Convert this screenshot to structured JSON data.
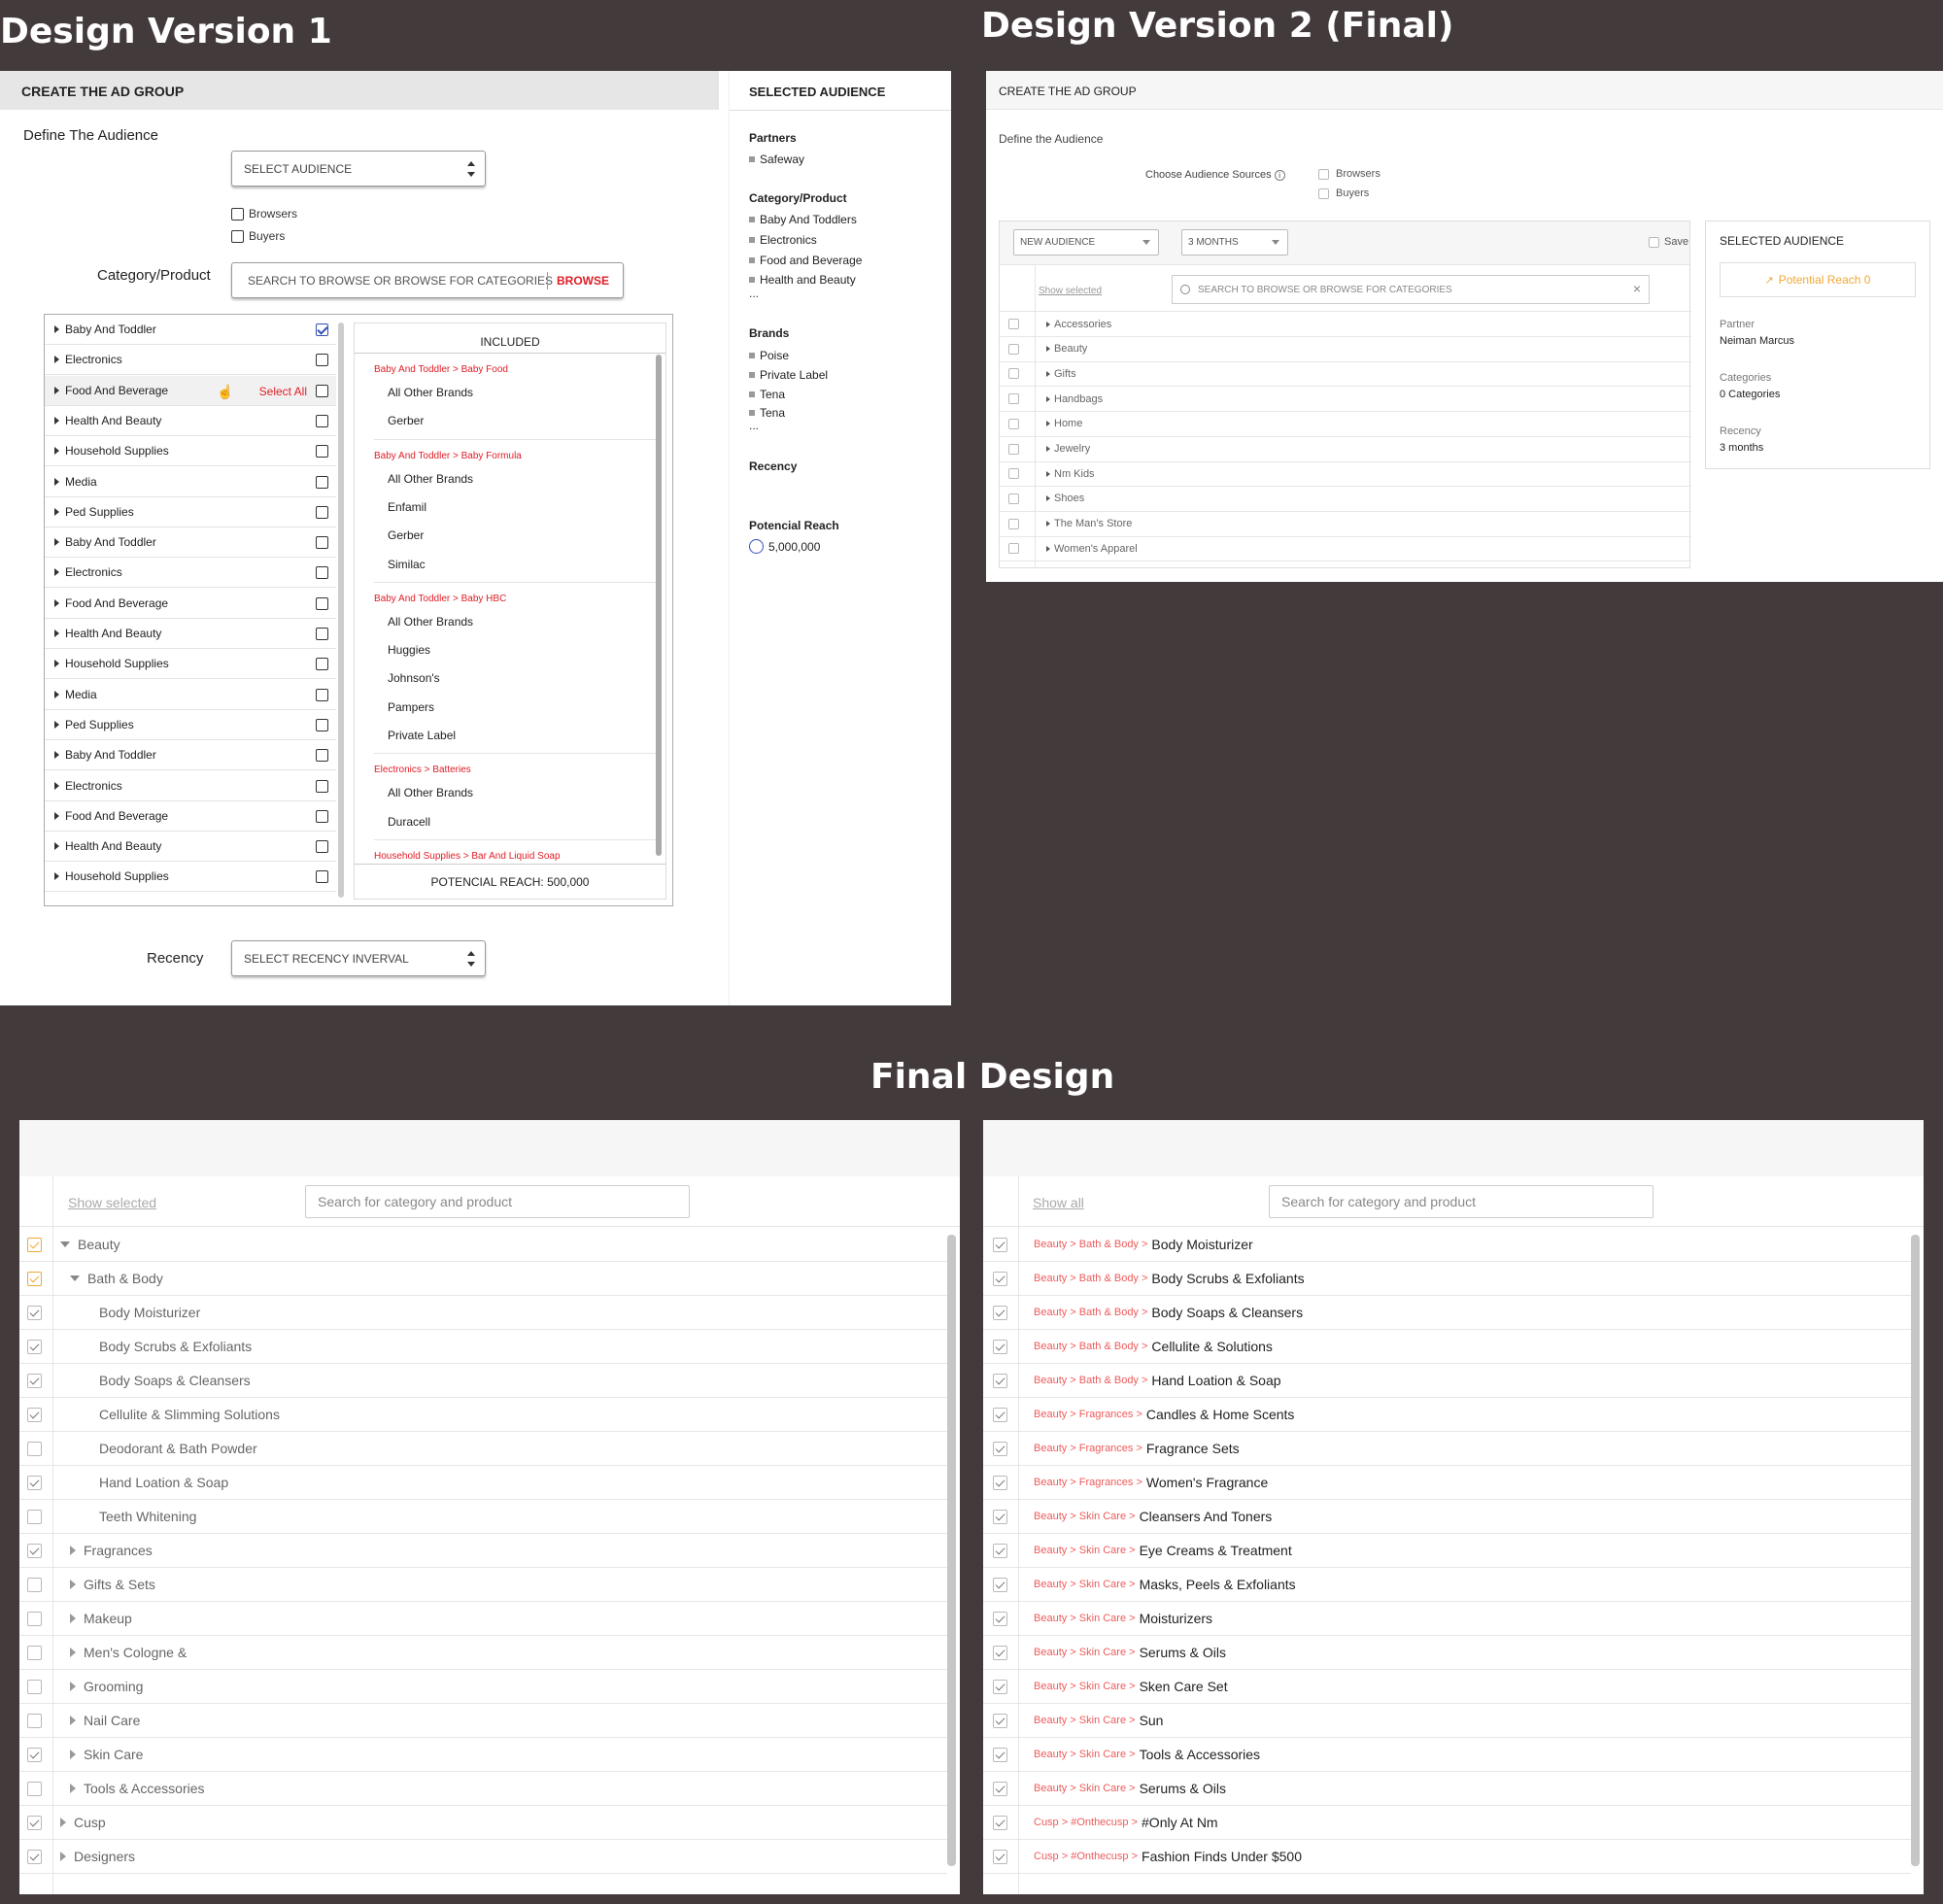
{
  "titles": {
    "v1": "Design Version 1",
    "v2": "Design Version 2 (Final)",
    "final": "Final Design"
  },
  "v1": {
    "header": "CREATE THE AD GROUP",
    "define_label": "Define The Audience",
    "select_audience": "SELECT AUDIENCE",
    "browsers": "Browsers",
    "buyers": "Buyers",
    "category_label": "Category/Product",
    "search_placeholder": "SEARCH TO BROWSE OR  BROWSE FOR CATEGORIES",
    "browse": "BROWSE",
    "select_all": "Select All",
    "categories": [
      {
        "label": "Baby And Toddler",
        "checked": true
      },
      {
        "label": "Electronics",
        "checked": false
      },
      {
        "label": "Food And Beverage",
        "checked": false,
        "hover": true
      },
      {
        "label": "Health And Beauty",
        "checked": false
      },
      {
        "label": "Household Supplies",
        "checked": false
      },
      {
        "label": "Media",
        "checked": false
      },
      {
        "label": "Ped Supplies",
        "checked": false
      },
      {
        "label": "Baby And Toddler",
        "checked": false
      },
      {
        "label": "Electronics",
        "checked": false
      },
      {
        "label": "Food And Beverage",
        "checked": false
      },
      {
        "label": "Health And Beauty",
        "checked": false
      },
      {
        "label": "Household Supplies",
        "checked": false
      },
      {
        "label": "Media",
        "checked": false
      },
      {
        "label": "Ped Supplies",
        "checked": false
      },
      {
        "label": "Baby And Toddler",
        "checked": false
      },
      {
        "label": "Electronics",
        "checked": false
      },
      {
        "label": "Food And Beverage",
        "checked": false
      },
      {
        "label": "Health And Beauty",
        "checked": false
      },
      {
        "label": "Household Supplies",
        "checked": false
      }
    ],
    "included_title": "INCLUDED",
    "included_groups": [
      {
        "head": "Baby And Toddler > Baby Food",
        "items": [
          "All Other Brands",
          "Gerber"
        ]
      },
      {
        "head": "Baby And Toddler > Baby Formula",
        "items": [
          "All Other Brands",
          "Enfamil",
          "Gerber",
          "Similac"
        ]
      },
      {
        "head": "Baby And Toddler > Baby HBC",
        "items": [
          "All Other Brands",
          "Huggies",
          "Johnson's",
          "Pampers",
          "Private Label"
        ]
      },
      {
        "head": "Electronics > Batteries",
        "items": [
          "All Other Brands",
          "Duracell"
        ]
      },
      {
        "head": "Household Supplies > Bar And Liquid Soap",
        "items": []
      }
    ],
    "potential_reach": "POTENCIAL REACH: 500,000",
    "recency_label": "Recency",
    "recency_select": "SELECT RECENCY INVERVAL",
    "selected": {
      "title": "SELECTED AUDIENCE",
      "partners_label": "Partners",
      "partners": [
        "Safeway"
      ],
      "category_label": "Category/Product",
      "categories": [
        "Baby And Toddlers",
        "Electronics",
        "Food and Beverage",
        "Health and Beauty"
      ],
      "ellipsis": "...",
      "brands_label": "Brands",
      "brands": [
        "Poise",
        "Private Label",
        "Tena",
        "Tena"
      ],
      "recency_label": "Recency",
      "reach_label": "Potencial Reach",
      "reach_value": "5,000,000"
    }
  },
  "v2": {
    "header": "CREATE THE AD GROUP",
    "define_label": "Define the Audience",
    "sources_label": "Choose Audience Sources",
    "browsers": "Browsers",
    "buyers": "Buyers",
    "audience_select": "NEW AUDIENCE",
    "months_select": "3 MONTHS",
    "save": "Save",
    "show_selected": "Show selected",
    "search_placeholder": "SEARCH TO BROWSE OR  BROWSE FOR CATEGORIES",
    "rows": [
      "Accessories",
      "Beauty",
      "Gifts",
      "Handbags",
      "Home",
      "Jewelry",
      "Nm Kids",
      "Shoes",
      "The Man's Store",
      "Women's Apparel"
    ],
    "selected": {
      "title": "SELECTED AUDIENCE",
      "reach": "Potential Reach 0",
      "partner_label": "Partner",
      "partner": "Neiman Marcus",
      "categories_label": "Categories",
      "categories": "0 Categories",
      "recency_label": "Recency",
      "recency": "3 months"
    }
  },
  "final_left": {
    "show_selected": "Show selected",
    "search_placeholder": "Search for category and product",
    "rows": [
      {
        "label": "Beauty",
        "level": 0,
        "expand": "open",
        "state": "orange"
      },
      {
        "label": "Bath & Body",
        "level": 1,
        "expand": "open",
        "state": "orange"
      },
      {
        "label": "Body Moisturizer",
        "level": 2,
        "expand": "none",
        "state": "on"
      },
      {
        "label": "Body Scrubs & Exfoliants",
        "level": 2,
        "expand": "none",
        "state": "on"
      },
      {
        "label": "Body Soaps & Cleansers",
        "level": 2,
        "expand": "none",
        "state": "on"
      },
      {
        "label": "Cellulite & Slimming Solutions",
        "level": 2,
        "expand": "none",
        "state": "on"
      },
      {
        "label": "Deodorant & Bath Powder",
        "level": 2,
        "expand": "none",
        "state": "off"
      },
      {
        "label": "Hand Loation & Soap",
        "level": 2,
        "expand": "none",
        "state": "on"
      },
      {
        "label": "Teeth Whitening",
        "level": 2,
        "expand": "none",
        "state": "off"
      },
      {
        "label": "Fragrances",
        "level": 1,
        "expand": "closed",
        "state": "on"
      },
      {
        "label": "Gifts & Sets",
        "level": 1,
        "expand": "closed",
        "state": "off"
      },
      {
        "label": "Makeup",
        "level": 1,
        "expand": "closed",
        "state": "off"
      },
      {
        "label": "Men's Cologne &",
        "level": 1,
        "expand": "closed",
        "state": "off"
      },
      {
        "label": "Grooming",
        "level": 1,
        "expand": "closed",
        "state": "off"
      },
      {
        "label": "Nail Care",
        "level": 1,
        "expand": "closed",
        "state": "off"
      },
      {
        "label": "Skin Care",
        "level": 1,
        "expand": "closed",
        "state": "on"
      },
      {
        "label": "Tools & Accessories",
        "level": 1,
        "expand": "closed",
        "state": "off"
      },
      {
        "label": "Cusp",
        "level": 0,
        "expand": "closed",
        "state": "on"
      },
      {
        "label": "Designers",
        "level": 0,
        "expand": "closed",
        "state": "on"
      }
    ]
  },
  "final_right": {
    "show_all": "Show all",
    "search_placeholder": "Search for category and product",
    "rows": [
      {
        "path": "Beauty > Bath & Body >",
        "leaf": "Body Moisturizer"
      },
      {
        "path": "Beauty > Bath & Body >",
        "leaf": "Body Scrubs & Exfoliants"
      },
      {
        "path": "Beauty > Bath & Body >",
        "leaf": "Body Soaps & Cleansers"
      },
      {
        "path": "Beauty > Bath & Body >",
        "leaf": "Cellulite & Solutions"
      },
      {
        "path": "Beauty > Bath & Body >",
        "leaf": "Hand Loation & Soap"
      },
      {
        "path": "Beauty > Fragrances >",
        "leaf": "Candles & Home Scents"
      },
      {
        "path": "Beauty > Fragrances >",
        "leaf": "Fragrance Sets"
      },
      {
        "path": "Beauty > Fragrances >",
        "leaf": "Women's Fragrance"
      },
      {
        "path": "Beauty > Skin Care >",
        "leaf": "Cleansers And Toners"
      },
      {
        "path": "Beauty > Skin Care >",
        "leaf": "Eye Creams & Treatment"
      },
      {
        "path": "Beauty > Skin Care >",
        "leaf": "Masks, Peels & Exfoliants"
      },
      {
        "path": "Beauty > Skin Care >",
        "leaf": "Moisturizers"
      },
      {
        "path": "Beauty > Skin Care >",
        "leaf": "Serums & Oils"
      },
      {
        "path": "Beauty > Skin Care >",
        "leaf": "Sken Care Set"
      },
      {
        "path": "Beauty > Skin Care >",
        "leaf": "Sun"
      },
      {
        "path": "Beauty > Skin Care >",
        "leaf": "Tools & Accessories"
      },
      {
        "path": "Beauty > Skin Care >",
        "leaf": "Serums & Oils"
      },
      {
        "path": "Cusp > #Onthecusp >",
        "leaf": "#Only At Nm"
      },
      {
        "path": "Cusp > #Onthecusp >",
        "leaf": "Fashion Finds Under $500"
      }
    ]
  },
  "colors": {
    "background": "#433a3c",
    "accent_red": "#e01d25",
    "accent_orange": "#f0a838",
    "path_red": "#ef5a5a"
  }
}
